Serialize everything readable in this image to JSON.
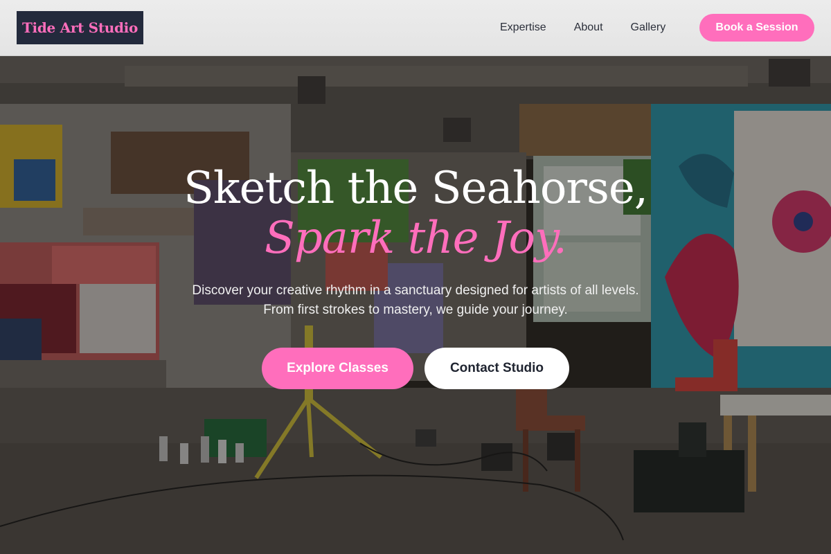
{
  "header": {
    "logo_text": "Tide Art Studio",
    "nav": [
      {
        "label": "Expertise"
      },
      {
        "label": "About"
      },
      {
        "label": "Gallery"
      }
    ],
    "cta_label": "Book a Session"
  },
  "hero": {
    "title_line1": "Sketch the Seahorse,",
    "title_line2": "Spark the Joy.",
    "subtitle": "Discover your creative rhythm in a sanctuary designed for artists of all levels. From first strokes to mastery, we guide your journey.",
    "primary_button": "Explore Classes",
    "secondary_button": "Contact Studio"
  },
  "colors": {
    "accent_pink": "#ff6ebc",
    "logo_bg": "#232a3c",
    "header_bg": "#e8e8e8",
    "nav_text": "#2b2f3a"
  },
  "background": {
    "subject": "graffiti-covered art studio interior photo"
  }
}
